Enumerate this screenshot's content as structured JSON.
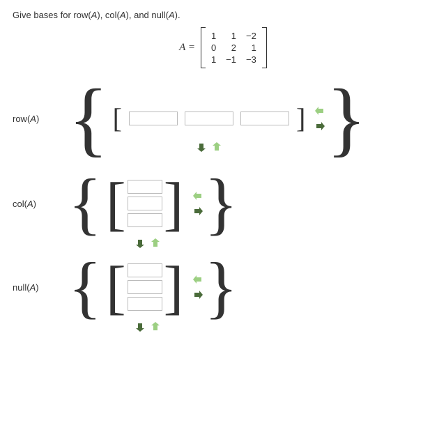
{
  "prompt": {
    "prefix": "Give bases for row(",
    "a1": "A",
    "mid1": "), col(",
    "a2": "A",
    "mid2": "), and null(",
    "a3": "A",
    "suffix": ")."
  },
  "matrix": {
    "lhs": "A =",
    "rows": [
      [
        "1",
        "1",
        "−2"
      ],
      [
        "0",
        "2",
        "1"
      ],
      [
        "1",
        "−1",
        "−3"
      ]
    ]
  },
  "sections": {
    "row": {
      "label_pre": "row(",
      "var": "A",
      "label_post": ")"
    },
    "col": {
      "label_pre": "col(",
      "var": "A",
      "label_post": ")"
    },
    "null": {
      "label_pre": "null(",
      "var": "A",
      "label_post": ")"
    }
  },
  "inputs": {
    "row": {
      "v1": [
        "",
        "",
        ""
      ]
    },
    "col": {
      "v1": [
        "",
        "",
        ""
      ]
    },
    "null": {
      "v1": [
        "",
        "",
        ""
      ]
    }
  },
  "icons": {
    "collapse": "collapse-icon",
    "expand": "expand-icon",
    "down": "down-icon",
    "up": "up-icon"
  }
}
